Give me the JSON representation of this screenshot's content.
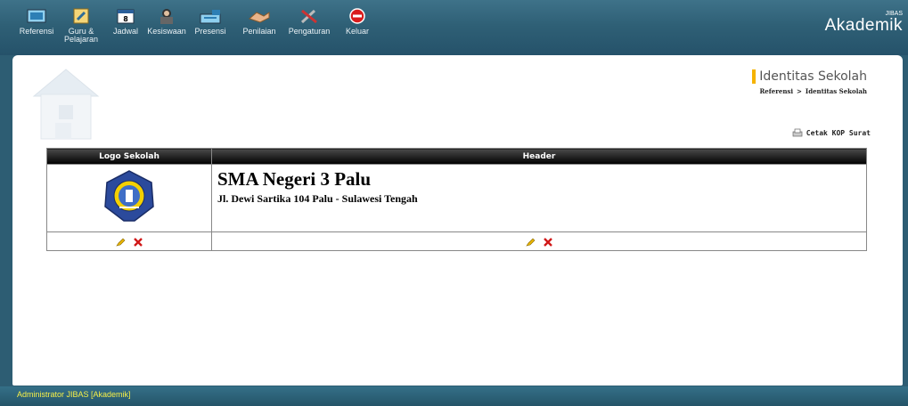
{
  "nav": {
    "items": [
      {
        "label": "Referensi"
      },
      {
        "label": "Guru &\nPelajaran"
      },
      {
        "label": "Jadwal"
      },
      {
        "label": "Kesiswaan"
      },
      {
        "label": "Presensi"
      },
      {
        "label": "Penilaian"
      },
      {
        "label": "Pengaturan"
      },
      {
        "label": "Keluar"
      }
    ],
    "calendar_number": "8"
  },
  "brand": {
    "name": "Akademik",
    "sup": "JIBAS"
  },
  "header": {
    "title": "Identitas Sekolah",
    "breadcrumb": [
      "Referensi",
      "Identitas Sekolah"
    ],
    "breadcrumb_sep": ">"
  },
  "print_link": "Cetak KOP Surat",
  "table": {
    "columns": [
      "Logo Sekolah",
      "Header"
    ],
    "school_name": "SMA Negeri 3 Palu",
    "school_address": "Jl. Dewi Sartika 104 Palu - Sulawesi Tengah"
  },
  "footer": {
    "user": "Administrator JIBAS [Akademik]"
  },
  "colors": {
    "accent": "#f5b300",
    "topbar": "#2f6076",
    "footer_text": "#f6ef48"
  }
}
